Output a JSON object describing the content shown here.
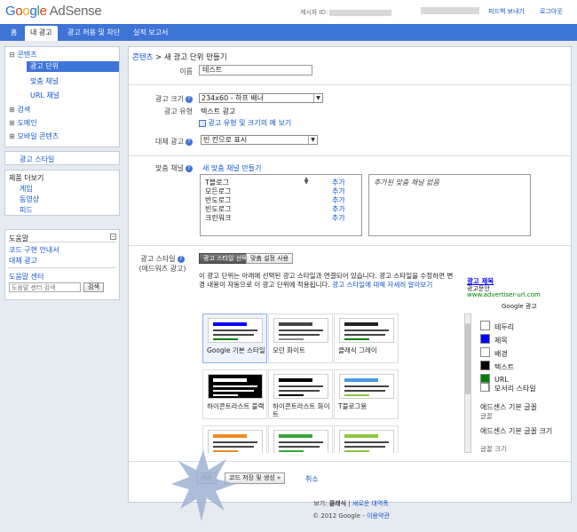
{
  "header": {
    "logo_google": "Google",
    "logo_product": "AdSense",
    "publisher_id_label": "게시자 ID:",
    "feedback": "피드백 보내기",
    "logout": "로그아웃"
  },
  "nav": {
    "tabs": [
      "홈",
      "내 광고",
      "광고 허용 및 차단",
      "실적 보고서"
    ],
    "active": 1
  },
  "sidebar": {
    "tree": [
      {
        "label": "콘텐츠",
        "expander": "⊟"
      },
      {
        "label": "광고 단위",
        "selected": true
      },
      {
        "label": "맞춤 채널"
      },
      {
        "label": "URL 채널"
      },
      {
        "label": "검색",
        "expander": "⊞"
      },
      {
        "label": "도메인",
        "expander": "⊞"
      },
      {
        "label": "모바일 콘텐츠",
        "expander": "⊞"
      }
    ],
    "ad_style": "광고 스타일",
    "products_title": "제품 더보기",
    "products": [
      "게임",
      "동영상",
      "피드"
    ],
    "help_title": "도움말",
    "help_links": [
      "코드 구현 안내서",
      "대체 광고"
    ],
    "help_center": "도움말 센터",
    "help_search_placeholder": "도움말 센터 검색",
    "help_search_button": "검색"
  },
  "page": {
    "breadcrumb_link": "콘텐츠",
    "breadcrumb_rest": " > 새 광고 단위 만들기",
    "name_label": "이름",
    "name_value": "테스트",
    "size_label": "광고 크기",
    "size_value": "234x60 - 하프 배너",
    "type_label": "광고 유형",
    "type_value": "텍스트 광고",
    "type_link": "광고 유형 및 크기의 예 보기",
    "backup_label": "대체 광고",
    "backup_value": "빈 칸으로 표시",
    "channel_label": "맞춤 채널",
    "channel_new": "새 맞춤 채널 만들기",
    "channels": [
      "T블로그",
      "모든로그",
      "반도로그",
      "빈도로그",
      "크린워크"
    ],
    "channel_add": "추가",
    "channel_empty": "추가된 맞춤 채널 없음",
    "style_label": "광고 스타일",
    "style_sublabel": "(애드워즈 광고)",
    "style_btn_existing": "광고 스타일 선택",
    "style_btn_new": "맞춤 설정 사용",
    "style_desc": "이 광고 단위는 아래에 선택된 광고 스타일과 연결되어 있습니다. 광고 스타일을 수정하면 변경 내용이 자동으로 이 광고 단위에 적용됩니다.",
    "style_desc_link": "광고 스타일에 대해 자세히 알아보기",
    "preview": {
      "title": "광고 제목",
      "text": "광고문안",
      "url": "www.advertiser-url.com",
      "google_ads": "Google 광고"
    },
    "palettes": [
      {
        "name": "Google 기본 스타일",
        "bg": "#ffffff",
        "title": "#0000ff",
        "url": "#008000"
      },
      {
        "name": "모던 화이트",
        "bg": "#ffffff",
        "title": "#444444",
        "url": "#888888"
      },
      {
        "name": "클래식 그레이",
        "bg": "#ffffff",
        "title": "#222222",
        "url": "#008000"
      },
      {
        "name": "하이콘트라스트 블랙",
        "bg": "#000000",
        "title": "#ffffff",
        "url": "#ffffff"
      },
      {
        "name": "하이콘트라스트 화이트",
        "bg": "#ffffff",
        "title": "#000000",
        "url": "#000000"
      },
      {
        "name": "T블로그용",
        "bg": "#ffffff",
        "title": "#4a9be0",
        "url": "#8cc63f"
      },
      {
        "name": "",
        "bg": "#ffffff",
        "title": "#f08a24",
        "url": "#f08a24"
      },
      {
        "name": "",
        "bg": "#ffffff",
        "title": "#3aa23a",
        "url": "#3aa23a"
      },
      {
        "name": "",
        "bg": "#ffffff",
        "title": "#8cc63f",
        "url": "#8cc63f"
      }
    ],
    "colors": [
      {
        "label": "테두리",
        "color": "#ffffff"
      },
      {
        "label": "제목",
        "color": "#0000ff"
      },
      {
        "label": "배경",
        "color": "#ffffff"
      },
      {
        "label": "텍스트",
        "color": "#000000"
      },
      {
        "label": "URL",
        "color": "#008000"
      }
    ],
    "corner_label": "모서리 스타일",
    "font_family_label": "애드센스 기본 글꼴",
    "font_family_value": "글꼴",
    "font_size_label": "애드센스 기본 글꼴 크기",
    "font_size_value": "글꼴 크기",
    "save": "저장",
    "save_get_code": "코드 저장 및 생성 »",
    "cancel": "취소"
  },
  "footer": {
    "view_label": "보기:",
    "view_classic": "클래식",
    "view_sep": " | ",
    "view_new": "새로운 대역폭",
    "copyright": "© 2012 Google - ",
    "privacy": "이용약관"
  }
}
